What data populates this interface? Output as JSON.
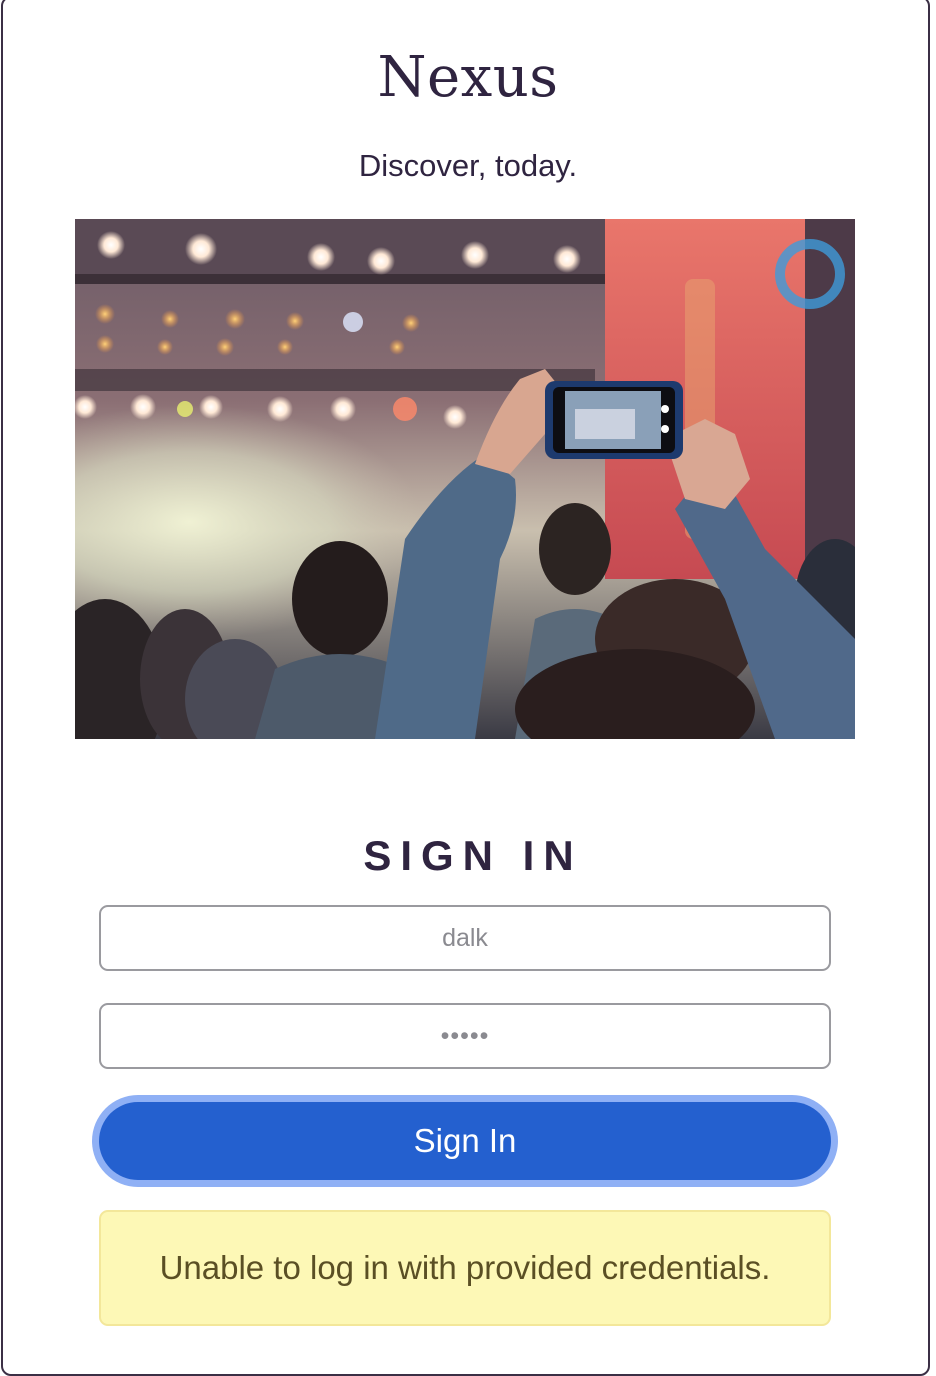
{
  "app": {
    "brand_name": "Nexus",
    "tagline": "Discover, today."
  },
  "signin": {
    "heading": "SIGN IN",
    "username_value": "dalk",
    "password_value": "•••••",
    "submit_label": "Sign In"
  },
  "alert": {
    "message": "Unable to log in with provided credentials."
  },
  "colors": {
    "text_primary": "#2f2440",
    "button_bg": "#2460cf",
    "button_focus_ring": "#8fb0f5",
    "alert_bg": "#fdf8b6",
    "alert_text": "#5a4f24",
    "field_border": "#9a9a9f"
  },
  "hero_image": {
    "icon": "concert-photo-image"
  }
}
